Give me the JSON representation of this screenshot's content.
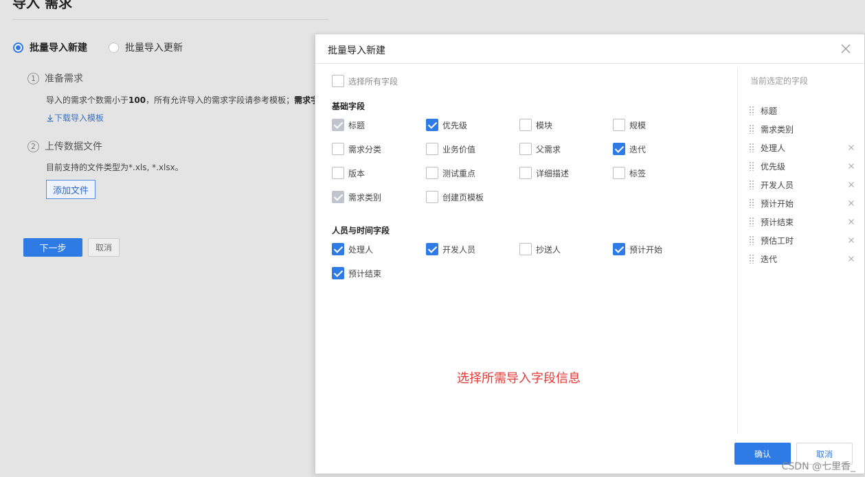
{
  "background": {
    "title": "导入 需求",
    "radio_options": [
      {
        "label": "批量导入新建",
        "selected": true
      },
      {
        "label": "批量导入更新",
        "selected": false
      }
    ],
    "step1": {
      "number": "1",
      "title": "准备需求",
      "desc_prefix": "导入的需求个数需小于",
      "desc_bold1": "100",
      "desc_mid": "，所有允许导入的需求字段请参考模板；",
      "desc_bold2": "需求字",
      "download_link": "下载导入模板"
    },
    "step2": {
      "number": "2",
      "title": "上传数据文件",
      "desc": "目前支持的文件类型为*.xls, *.xlsx。",
      "add_file": "添加文件"
    },
    "next_button": "下一步",
    "cancel_button": "取消"
  },
  "modal": {
    "title": "批量导入新建",
    "select_all": "选择所有字段",
    "groups": [
      {
        "title": "基础字段",
        "fields": [
          {
            "label": "标题",
            "state": "disabled"
          },
          {
            "label": "优先级",
            "state": "checked"
          },
          {
            "label": "模块",
            "state": "unchecked"
          },
          {
            "label": "规模",
            "state": "unchecked"
          },
          {
            "label": "需求分类",
            "state": "unchecked"
          },
          {
            "label": "业务价值",
            "state": "unchecked"
          },
          {
            "label": "父需求",
            "state": "unchecked"
          },
          {
            "label": "迭代",
            "state": "checked"
          },
          {
            "label": "版本",
            "state": "unchecked"
          },
          {
            "label": "测试重点",
            "state": "unchecked"
          },
          {
            "label": "详细描述",
            "state": "unchecked"
          },
          {
            "label": "标签",
            "state": "unchecked"
          },
          {
            "label": "需求类别",
            "state": "disabled"
          },
          {
            "label": "创建页模板",
            "state": "unchecked"
          }
        ]
      },
      {
        "title": "人员与时间字段",
        "fields": [
          {
            "label": "处理人",
            "state": "checked"
          },
          {
            "label": "开发人员",
            "state": "checked"
          },
          {
            "label": "抄送人",
            "state": "unchecked"
          },
          {
            "label": "预计开始",
            "state": "checked"
          },
          {
            "label": "预计结束",
            "state": "checked"
          }
        ]
      }
    ],
    "hint": "选择所需导入字段信息",
    "selected_title": "当前选定的字段",
    "selected_fields": [
      {
        "label": "标题",
        "removable": false
      },
      {
        "label": "需求类别",
        "removable": false
      },
      {
        "label": "处理人",
        "removable": true
      },
      {
        "label": "优先级",
        "removable": true
      },
      {
        "label": "开发人员",
        "removable": true
      },
      {
        "label": "预计开始",
        "removable": true
      },
      {
        "label": "预计结束",
        "removable": true
      },
      {
        "label": "预估工时",
        "removable": true
      },
      {
        "label": "迭代",
        "removable": true
      }
    ],
    "ok_button": "确认",
    "cancel_button": "取消"
  },
  "watermark": "CSDN @七里香_",
  "colors": {
    "accent": "#2f7be6",
    "hint": "#e53935",
    "disabled_check": "#c0c4cc"
  }
}
